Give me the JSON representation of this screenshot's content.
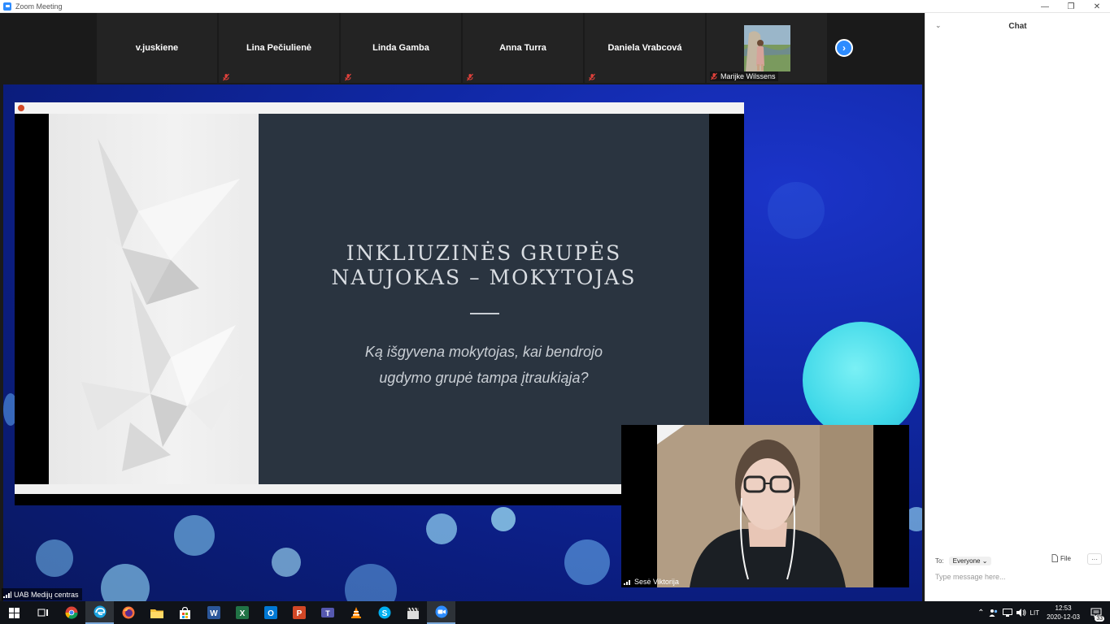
{
  "window": {
    "title": "Zoom Meeting",
    "controls": {
      "minimize": "—",
      "restore": "❐",
      "close": "✕"
    }
  },
  "participants": [
    {
      "name": "v.juskiene",
      "muted": false
    },
    {
      "name": "Lina Pečiulienė",
      "muted": true
    },
    {
      "name": "Linda Gamba",
      "muted": true
    },
    {
      "name": "Anna Turra",
      "muted": true
    },
    {
      "name": "Daniela Vrabcová",
      "muted": true
    },
    {
      "name": "Marijke Wilssens",
      "muted": true,
      "has_video": true
    }
  ],
  "strip": {
    "next_icon": "chevron-right-icon"
  },
  "shared_screen": {
    "slide": {
      "title_line1": "INKLIUZINĖS GRUPĖS",
      "title_line2": "NAUJOKAS – MOKYTOJAS",
      "subtitle_line1": "Ką išgyvena mokytojas, kai bendrojo",
      "subtitle_line2": "ugdymo grupė tampa įtraukiąja?"
    },
    "presenter_video": {
      "name": "Sesė Viktorija"
    },
    "sharer_name": "UAB Medijų centras"
  },
  "chat": {
    "header": "Chat",
    "to_label": "To:",
    "to_value": "Everyone",
    "file_label": "File",
    "more_label": "···",
    "input_placeholder": "Type message here..."
  },
  "taskbar": {
    "apps": [
      "start-icon",
      "task-view-icon",
      "chrome-icon",
      "edge-icon",
      "firefox-icon",
      "file-explorer-icon",
      "store-icon",
      "word-icon",
      "excel-icon",
      "outlook-icon",
      "powerpoint-icon",
      "teams-icon",
      "vlc-icon",
      "skype-icon",
      "clapperboard-icon",
      "zoom-icon"
    ],
    "language": "LIT",
    "time": "12:53",
    "date": "2020-12-03",
    "notifications": "33"
  }
}
